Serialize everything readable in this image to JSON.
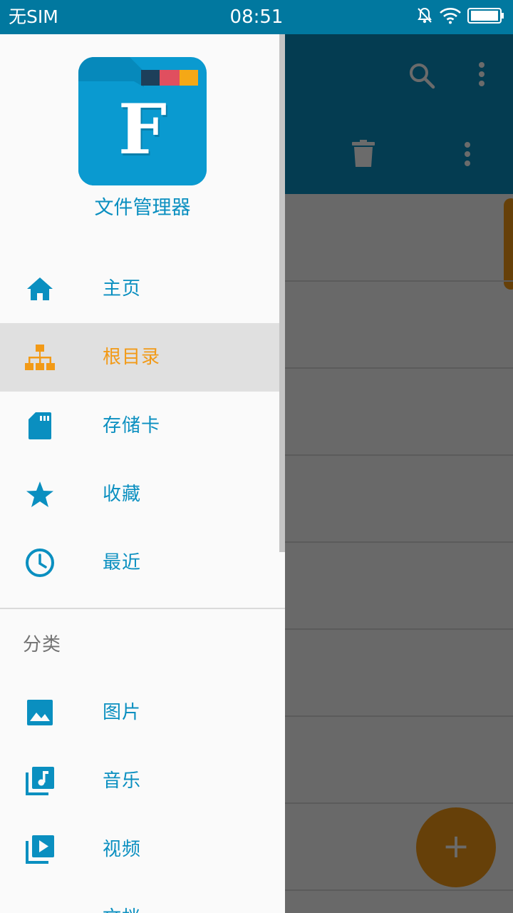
{
  "status_bar": {
    "carrier": "无SIM",
    "time": "08:51"
  },
  "drawer": {
    "app_name": "文件管理器",
    "logo_letter": "F",
    "nav_items": [
      {
        "label": "主页",
        "icon": "home-icon",
        "active": false
      },
      {
        "label": "根目录",
        "icon": "sitemap-icon",
        "active": true
      },
      {
        "label": "存储卡",
        "icon": "sd-card-icon",
        "active": false
      },
      {
        "label": "收藏",
        "icon": "star-icon",
        "active": false
      },
      {
        "label": "最近",
        "icon": "clock-icon",
        "active": false
      }
    ],
    "section_title": "分类",
    "category_items": [
      {
        "label": "图片",
        "icon": "image-icon"
      },
      {
        "label": "音乐",
        "icon": "music-library-icon"
      },
      {
        "label": "视频",
        "icon": "video-library-icon"
      },
      {
        "label": "文档",
        "icon": "documents-icon"
      }
    ]
  },
  "background_app": {
    "fab_label": "+"
  },
  "colors": {
    "status_bar": "#01789f",
    "primary": "#0a8fc0",
    "accent": "#f29a17",
    "active_bg": "#e0e0e0"
  }
}
